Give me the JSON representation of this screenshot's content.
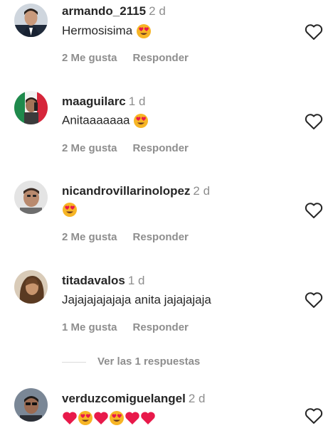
{
  "comments": [
    {
      "username": "armando_2115",
      "time": "2 d",
      "text": "Hermosisima",
      "emojis": [
        "heart-eyes-icon"
      ],
      "likes": "2 Me gusta",
      "reply_label": "Responder"
    },
    {
      "username": "maaguilarc",
      "time": "1 d",
      "text": "Anitaaaaaaa",
      "emojis": [
        "heart-eyes-icon"
      ],
      "likes": "2 Me gusta",
      "reply_label": "Responder"
    },
    {
      "username": "nicandrovillarinolopez",
      "time": "2 d",
      "text": "",
      "emojis": [
        "heart-eyes-icon"
      ],
      "likes": "2 Me gusta",
      "reply_label": "Responder"
    },
    {
      "username": "titadavalos",
      "time": "1 d",
      "text": "Jajajajajajaja anita jajajajaja",
      "emojis": [],
      "likes": "1 Me gusta",
      "reply_label": "Responder"
    },
    {
      "username": "verduzcomiguelangel",
      "time": "2 d",
      "text": "",
      "emojis": [
        "red-heart-icon",
        "heart-eyes-icon",
        "red-heart-icon",
        "heart-eyes-icon",
        "red-heart-icon",
        "red-heart-icon"
      ]
    }
  ],
  "view_replies": "Ver las 1 respuestas",
  "colors": {
    "heart_red": "#e8194a",
    "emoji_yellow": "#f7b525",
    "muted": "#8e8e8e"
  }
}
